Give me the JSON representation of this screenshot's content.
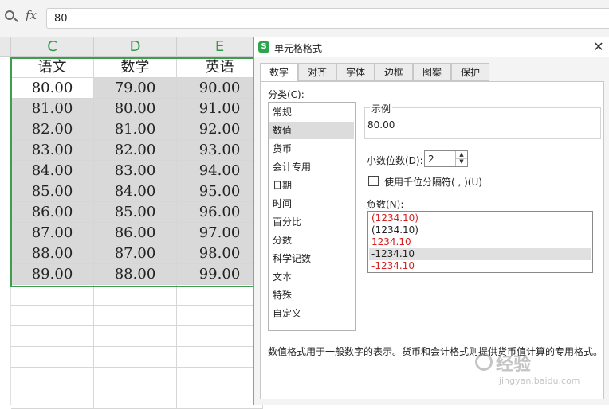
{
  "formula_bar": {
    "fx_label": "fx",
    "value": "80"
  },
  "sheet": {
    "columns": [
      "C",
      "D",
      "E"
    ],
    "headers": [
      "语文",
      "数学",
      "英语"
    ],
    "rows": [
      [
        "80.00",
        "79.00",
        "90.00"
      ],
      [
        "81.00",
        "80.00",
        "91.00"
      ],
      [
        "82.00",
        "81.00",
        "92.00"
      ],
      [
        "83.00",
        "82.00",
        "93.00"
      ],
      [
        "84.00",
        "83.00",
        "94.00"
      ],
      [
        "85.00",
        "84.00",
        "95.00"
      ],
      [
        "86.00",
        "85.00",
        "96.00"
      ],
      [
        "87.00",
        "86.00",
        "97.00"
      ],
      [
        "88.00",
        "87.00",
        "98.00"
      ],
      [
        "89.00",
        "88.00",
        "99.00"
      ]
    ],
    "selection_color": "#3e9d4e"
  },
  "dialog": {
    "title": "单元格格式",
    "close": "✕",
    "tabs": [
      "数字",
      "对齐",
      "字体",
      "边框",
      "图案",
      "保护"
    ],
    "active_tab": "数字",
    "category_label": "分类(C):",
    "categories": [
      "常规",
      "数值",
      "货币",
      "会计专用",
      "日期",
      "时间",
      "百分比",
      "分数",
      "科学记数",
      "文本",
      "特殊",
      "自定义"
    ],
    "selected_category": "数值",
    "sample_label": "示例",
    "sample_value": "80.00",
    "decimal_label": "小数位数(D):",
    "decimal_value": "2",
    "thousands_label": "使用千位分隔符( , )(U)",
    "thousands_checked": false,
    "negative_label": "负数(N):",
    "negative_options": [
      {
        "text": "(1234.10)",
        "color": "#d42020"
      },
      {
        "text": "(1234.10)",
        "color": "#222222"
      },
      {
        "text": "1234.10",
        "color": "#d42020"
      },
      {
        "text": "-1234.10",
        "color": "#222222"
      },
      {
        "text": "-1234.10",
        "color": "#d42020"
      }
    ],
    "selected_negative": 3,
    "description": "数值格式用于一般数字的表示。货币和会计格式则提供货币值计算的专用格式。"
  },
  "watermark": {
    "text": "经验",
    "site": "jingyan.baidu.com"
  }
}
